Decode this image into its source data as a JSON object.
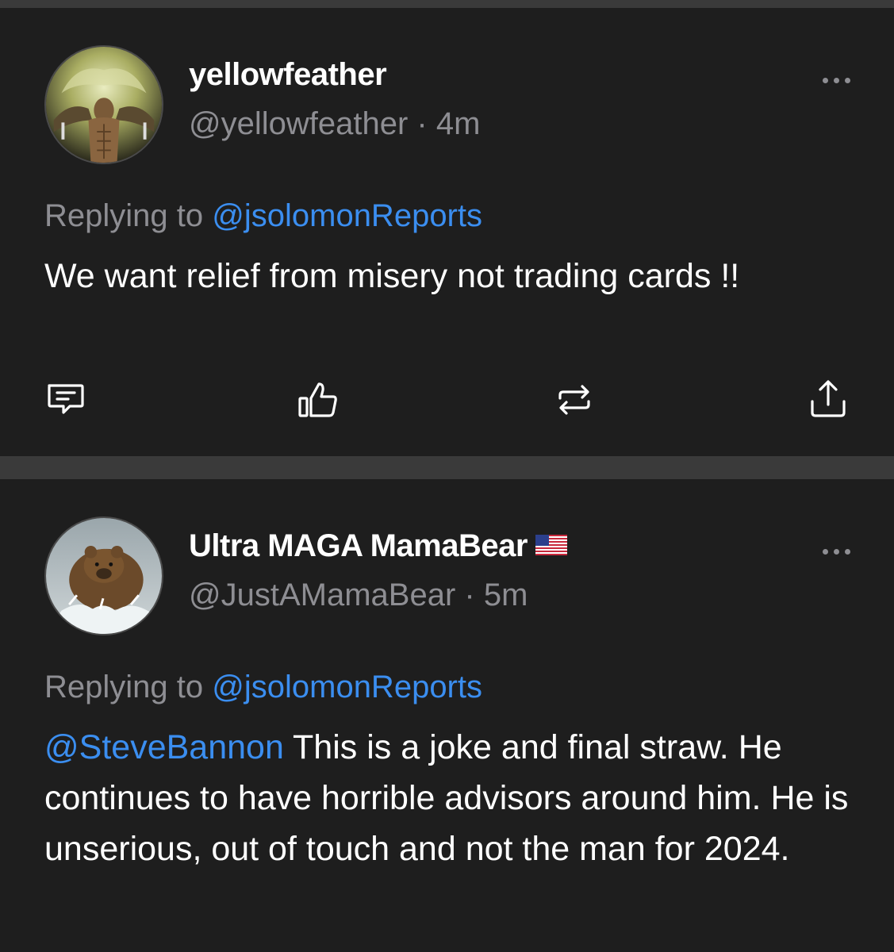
{
  "posts": [
    {
      "display_name": "yellowfeather",
      "handle": "@yellowfeather",
      "time_sep": "·",
      "time": "4m",
      "replying_prefix": "Replying to",
      "replying_to": "@jsolomonReports",
      "mention": "",
      "text": "We want relief from misery not trading cards !!",
      "avatar_icon": "muscular-figure-avatar",
      "actions": [
        "reply-icon",
        "like-icon",
        "repost-icon",
        "share-icon"
      ]
    },
    {
      "display_name": "Ultra MAGA MamaBear",
      "flag": "us-flag-icon",
      "handle": "@JustAMamaBear",
      "time_sep": "·",
      "time": "5m",
      "replying_prefix": "Replying to",
      "replying_to": "@jsolomonReports",
      "mention": "@SteveBannon",
      "text": " This is a joke and final straw. He continues to have horrible advisors around him. He is unserious, out of touch and not the man for 2024.",
      "avatar_icon": "bear-avatar"
    }
  ],
  "colors": {
    "background": "#1e1e1e",
    "divider": "#3a3a3a",
    "link": "#3b8ef0",
    "muted": "#8e8e93"
  }
}
